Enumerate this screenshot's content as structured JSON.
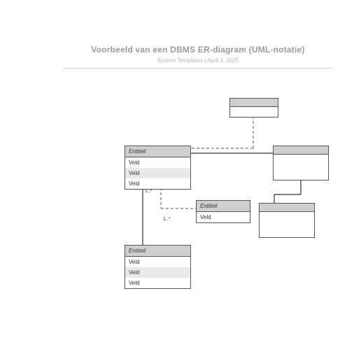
{
  "header": {
    "title": "Voorbeeld van een DBMS ER-diagram (UML-notatie)",
    "subtitle": "System Templates  |  April 3, 2025"
  },
  "entities": {
    "top": {
      "title": "",
      "fields": []
    },
    "left": {
      "title": "Entiteit",
      "fields": [
        "Veld",
        "Veld",
        "Veld"
      ]
    },
    "right": {
      "title": "",
      "fields": []
    },
    "center": {
      "title": "Entiteit",
      "fields": [
        "Veld"
      ]
    },
    "rightLower": {
      "title": "",
      "fields": []
    },
    "bottom": {
      "title": "Entiteit",
      "fields": [
        "Veld",
        "Veld",
        "Veld"
      ]
    }
  },
  "cardinalities": {
    "leftToBottom": "1..*",
    "leftToCenter": "1..*"
  }
}
